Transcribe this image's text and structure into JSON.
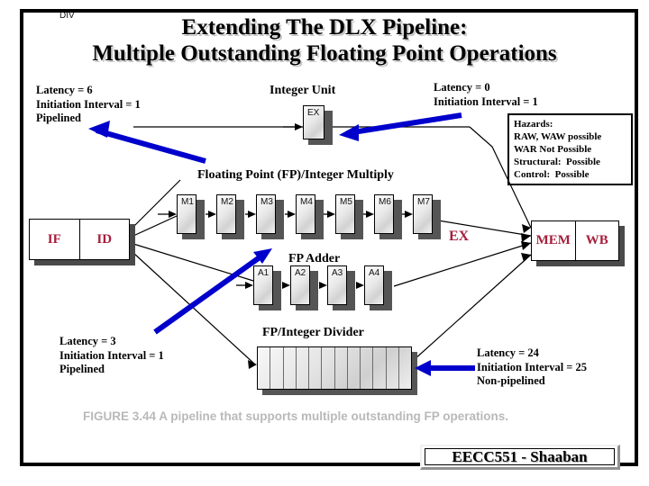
{
  "title": {
    "line1": "Extending The DLX Pipeline:",
    "line2": "Multiple Outstanding Floating Point Operations"
  },
  "notes": {
    "multiply": "Latency = 6\nInitiation Interval = 1\nPipelined",
    "integer": "Latency = 0\nInitiation Interval = 1",
    "adder": "Latency = 3\nInitiation Interval = 1\nPipelined",
    "divider": "Latency = 24\nInitiation Interval = 25\nNon-pipelined"
  },
  "hazards": {
    "text": "Hazards:\nRAW, WAW possible\nWAR Not Possible\nStructural:  Possible\nControl:  Possible"
  },
  "unit_labels": {
    "integer": "Integer Unit",
    "multiply": "Floating Point (FP)/Integer Multiply",
    "adder": "FP Adder",
    "divider": "FP/Integer Divider"
  },
  "stages": {
    "integer_ex": "EX",
    "multiply": [
      "M1",
      "M2",
      "M3",
      "M4",
      "M5",
      "M6",
      "M7"
    ],
    "adder": [
      "A1",
      "A2",
      "A3",
      "A4"
    ],
    "divider_label": "DIV",
    "divider_segments": 12
  },
  "registers": {
    "front": [
      "IF",
      "ID"
    ],
    "back": [
      "MEM",
      "WB"
    ],
    "ex_label": "EX"
  },
  "caption": "FIGURE 3.44  A pipeline that supports multiple outstanding FP operations.",
  "footer": {
    "label": "EECC551 - Shaaban"
  },
  "colors": {
    "accent_blue": "#0000cc",
    "register_text": "#a61e3c",
    "frame": "#000000",
    "caption": "#b9b9b9"
  }
}
